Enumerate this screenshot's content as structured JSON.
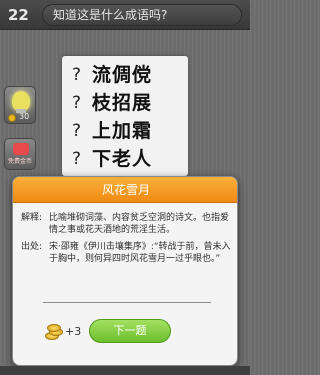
{
  "topbar": {
    "level": "22",
    "question": "知道这是什么成语吗?"
  },
  "sidebar": {
    "hint_cost": "30",
    "share_label": "免费金币"
  },
  "puzzle": {
    "rows": [
      {
        "mark": "?",
        "words": "流倜傥"
      },
      {
        "mark": "?",
        "words": "枝招展"
      },
      {
        "mark": "?",
        "words": "上加霜"
      },
      {
        "mark": "?",
        "words": "下老人"
      }
    ]
  },
  "dialog": {
    "title": "风花雪月",
    "explain_label": "解释:",
    "explain_text": "比喻堆砌词藻、内容贫乏空洞的诗文。也指爱情之事或花天酒地的荒淫生活。",
    "source_label": "出处:",
    "source_text": "宋·邵雍《伊川击壤集序》:“转战于前，曾未入于胸中，则何异四时风花雪月一过乎眼也。”",
    "reward": "+3",
    "next_label": "下一题"
  }
}
